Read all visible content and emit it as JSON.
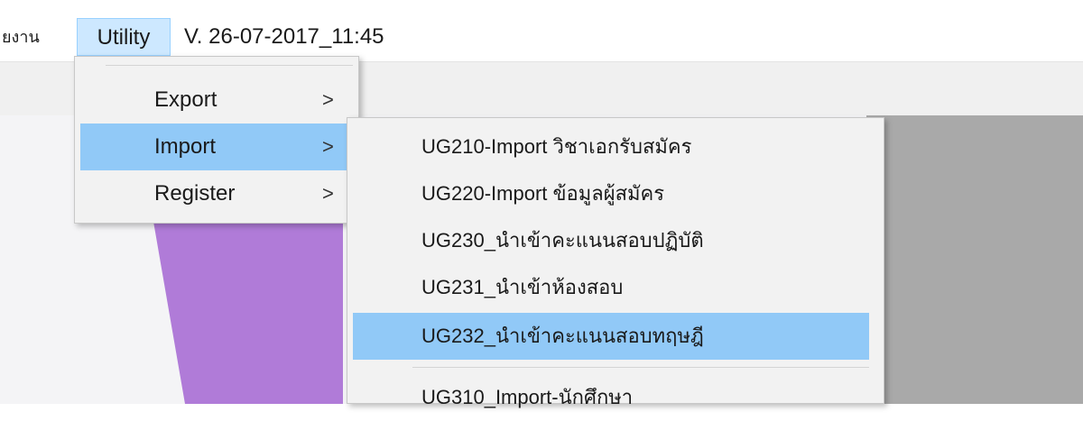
{
  "menubar": {
    "partial_item": "ยงาน",
    "utility_label": "Utility",
    "version_label": "V. 26-07-2017_11:45"
  },
  "utility_menu": {
    "items": [
      {
        "label": "Export",
        "arrow": ">",
        "highlighted": false
      },
      {
        "label": "Import",
        "arrow": ">",
        "highlighted": true
      },
      {
        "label": "Register",
        "arrow": ">",
        "highlighted": false
      }
    ]
  },
  "import_menu": {
    "items": [
      {
        "label": "UG210-Import วิชาเอกรับสมัคร",
        "highlighted": false
      },
      {
        "label": "UG220-Import ข้อมูลผู้สมัคร",
        "highlighted": false
      },
      {
        "label": "UG230_นำเข้าคะแนนสอบปฏิบัติ",
        "highlighted": false
      },
      {
        "label": "UG231_นำเข้าห้องสอบ",
        "highlighted": false
      },
      {
        "label": "UG232_นำเข้าคะแนนสอบทฤษฎี",
        "highlighted": true
      },
      {
        "label": "UG310_Import-นักศึกษา",
        "highlighted": false
      }
    ]
  },
  "colors": {
    "menu_highlight": "#91c9f7",
    "menubar_active": "#cde8ff",
    "graphic_purple": "#b07bd8",
    "graphic_gray": "#a9a9a9"
  }
}
